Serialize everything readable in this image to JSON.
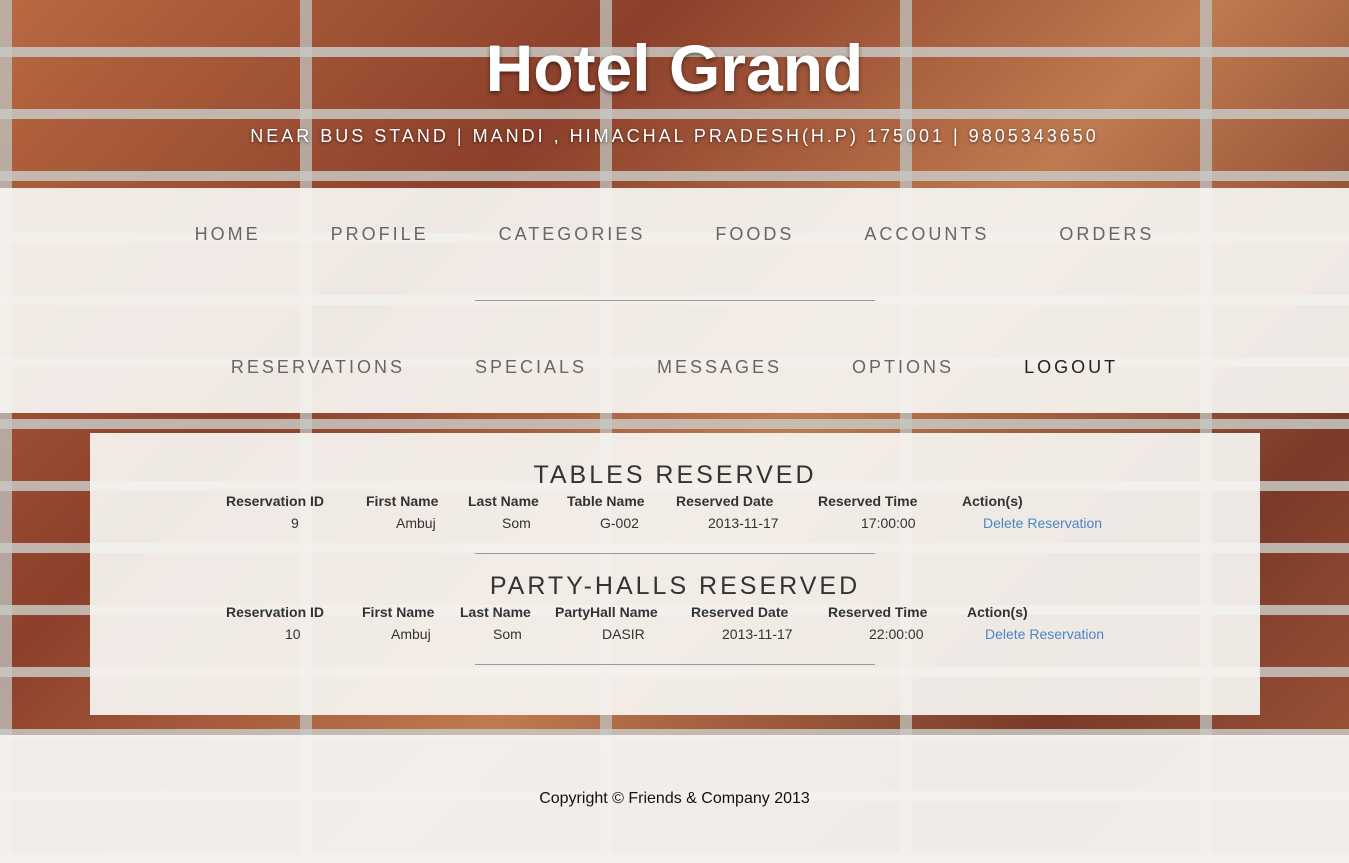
{
  "header": {
    "title": "Hotel Grand",
    "address": "NEAR BUS STAND | MANDI , HIMACHAL PRADESH(H.P) 175001 | 9805343650"
  },
  "nav": {
    "row1": [
      "HOME",
      "PROFILE",
      "CATEGORIES",
      "FOODS",
      "ACCOUNTS",
      "ORDERS"
    ],
    "row2": [
      "RESERVATIONS",
      "SPECIALS",
      "MESSAGES",
      "OPTIONS",
      "LOGOUT"
    ]
  },
  "tables_reserved": {
    "title": "TABLES RESERVED",
    "headers": [
      "Reservation ID",
      "First Name",
      "Last Name",
      "Table Name",
      "Reserved Date",
      "Reserved Time",
      "Action(s)"
    ],
    "rows": [
      {
        "id": "9",
        "first": "Ambuj",
        "last": "Som",
        "name": "G-002",
        "date": "2013-11-17",
        "time": "17:00:00",
        "action": "Delete Reservation"
      }
    ]
  },
  "halls_reserved": {
    "title": "PARTY-HALLS RESERVED",
    "headers": [
      "Reservation ID",
      "First Name",
      "Last Name",
      "PartyHall Name",
      "Reserved Date",
      "Reserved Time",
      "Action(s)"
    ],
    "rows": [
      {
        "id": "10",
        "first": "Ambuj",
        "last": "Som",
        "name": "DASIR",
        "date": "2013-11-17",
        "time": "22:00:00",
        "action": "Delete Reservation"
      }
    ]
  },
  "footer": {
    "copyright": "Copyright © Friends & Company 2013"
  }
}
